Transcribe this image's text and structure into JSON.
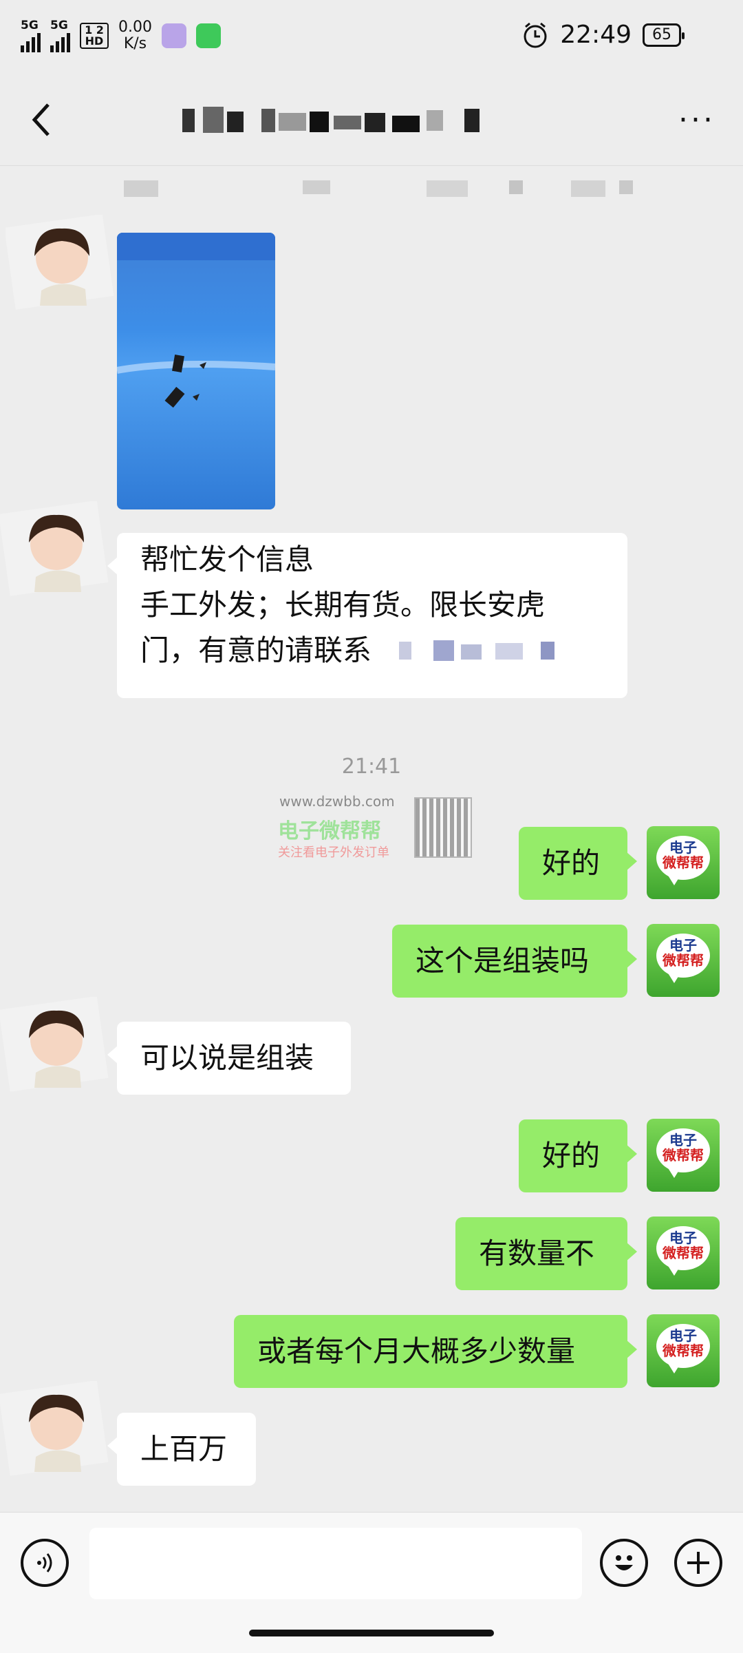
{
  "status_bar": {
    "signal_1": "5G",
    "signal_2": "5G",
    "hd_badge": "1 2 HD",
    "net_speed_value": "0.00",
    "net_speed_unit": "K/s",
    "time": "22:49",
    "battery": "65"
  },
  "header": {
    "more_label": "···"
  },
  "chat": {
    "messages": [
      {
        "from": "them",
        "type": "image"
      },
      {
        "from": "them",
        "type": "text",
        "lines": [
          "帮忙发个信息",
          "手工外发；长期有货。限长安虎",
          "门，有意的请联系"
        ]
      },
      {
        "type": "time",
        "text": "21:41"
      },
      {
        "from": "me",
        "type": "text",
        "text": "好的"
      },
      {
        "from": "me",
        "type": "text",
        "text": "这个是组装吗"
      },
      {
        "from": "them",
        "type": "text",
        "text": "可以说是组装"
      },
      {
        "from": "me",
        "type": "text",
        "text": "好的"
      },
      {
        "from": "me",
        "type": "text",
        "text": "有数量不"
      },
      {
        "from": "me",
        "type": "text",
        "text": "或者每个月大概多少数量"
      },
      {
        "from": "them",
        "type": "text",
        "text": "上百万"
      }
    ],
    "my_avatar": {
      "line1": "电子",
      "line2": "微帮帮"
    }
  },
  "watermark": {
    "url": "www.dzwbb.com",
    "name": "电子微帮帮",
    "tip": "关注看电子外发订单"
  },
  "input_bar": {
    "voice_icon": "voice-icon",
    "emoji_icon": "emoji-icon",
    "plus_icon": "plus-icon",
    "text_value": ""
  },
  "colors": {
    "background": "#ededed",
    "incoming_bubble": "#ffffff",
    "outgoing_bubble": "#95ec69"
  }
}
